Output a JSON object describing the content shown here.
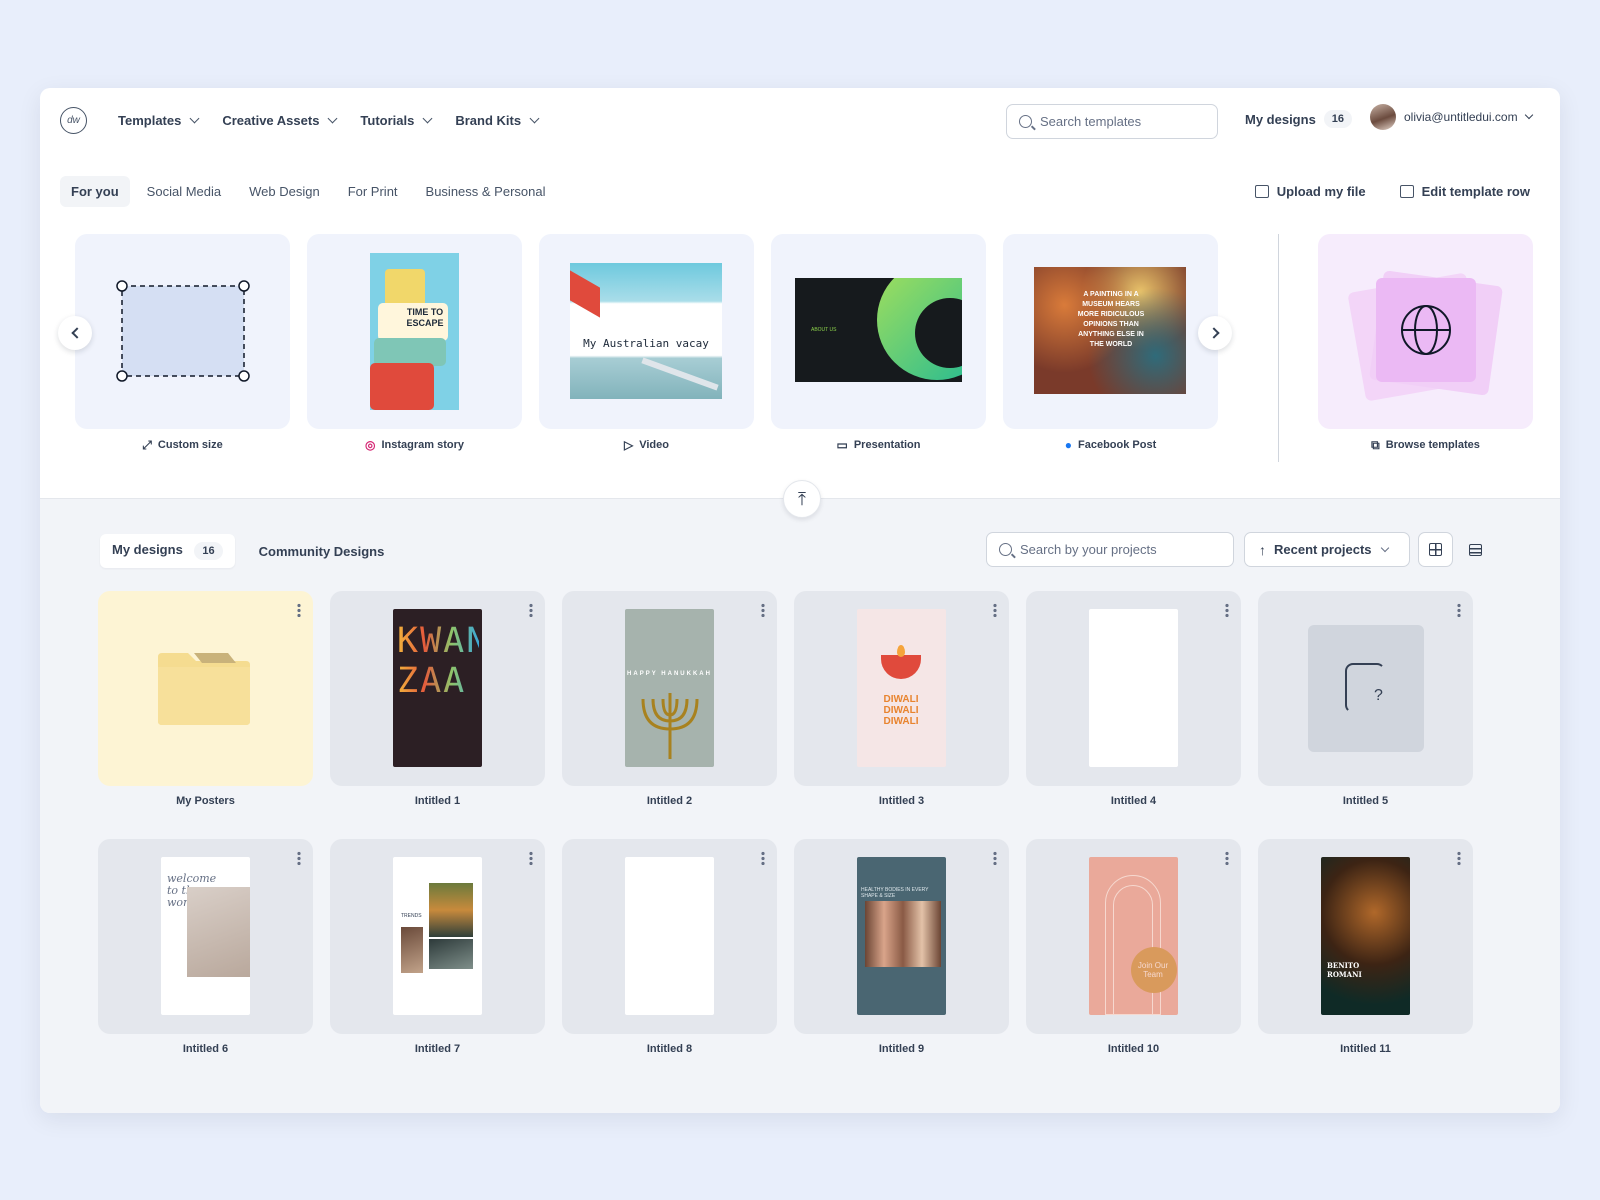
{
  "logo": {
    "text": "dw"
  },
  "nav": {
    "items": [
      "Templates",
      "Creative Assets",
      "Tutorials",
      "Brand Kits"
    ]
  },
  "search": {
    "placeholder": "Search templates"
  },
  "my_designs": {
    "label": "My designs",
    "count": "16"
  },
  "user": {
    "email": "olivia@untitledui.com"
  },
  "tabs": [
    "For you",
    "Social Media",
    "Web Design",
    "For Print",
    "Business & Personal"
  ],
  "actions": {
    "upload": "Upload my file",
    "edit_row": "Edit template row"
  },
  "templates": [
    {
      "label": "Custom size",
      "icon": "expand-icon"
    },
    {
      "label": "Instagram story",
      "icon": "instagram-icon",
      "thumb_text": "TIME TO ESCAPE"
    },
    {
      "label": "Video",
      "icon": "play-icon",
      "thumb_text": "My Australian vacay"
    },
    {
      "label": "Presentation",
      "icon": "presentation-icon",
      "thumb_text": "ABOUT US"
    },
    {
      "label": "Facebook Post",
      "icon": "facebook-icon",
      "thumb_text": "A PAINTING IN A MUSEUM HEARS MORE RIDICULOUS OPINIONS THAN ANYTHING ELSE IN THE WORLD"
    },
    {
      "label": "Browse templates",
      "icon": "external-link-icon"
    }
  ],
  "bottom_tabs": {
    "my_designs": "My designs",
    "count": "16",
    "community": "Community Designs"
  },
  "project_search": {
    "placeholder": "Search by your projects"
  },
  "sort": {
    "label": "Recent projects"
  },
  "designs": [
    {
      "label": "My Posters",
      "type": "folder"
    },
    {
      "label": "Intitled 1",
      "thumb_text": "KWAN ZAA"
    },
    {
      "label": "Intitled 2",
      "thumb_text": "HAPPY HANUKKAH"
    },
    {
      "label": "Intitled 3",
      "thumb_text": "DIWALI DIWALI DIWALI"
    },
    {
      "label": "Intitled 4"
    },
    {
      "label": "Intitled 5"
    },
    {
      "label": "Intitled 6",
      "thumb_text": "welcome to the world"
    },
    {
      "label": "Intitled 7",
      "thumb_text": "TRENDS"
    },
    {
      "label": "Intitled 8"
    },
    {
      "label": "Intitled 9",
      "thumb_text": "HEALTHY BODIES IN EVERY SHAPE & SIZE"
    },
    {
      "label": "Intitled 10",
      "thumb_text": "Join Our Team"
    },
    {
      "label": "Intitled 11",
      "thumb_text": "BENITO ROMANI"
    }
  ]
}
